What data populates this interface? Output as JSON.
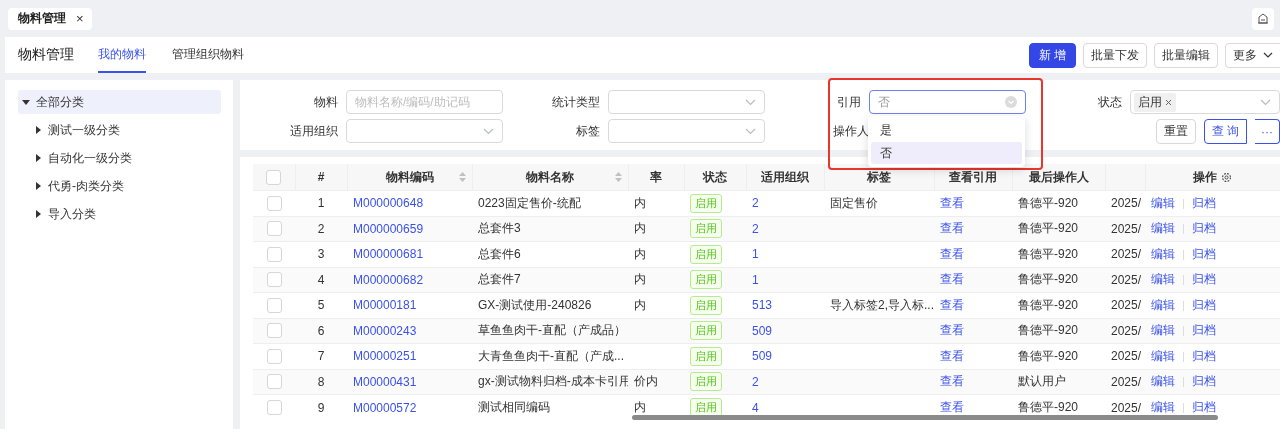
{
  "app_tabs": [
    {
      "label": "物料管理",
      "selected": true,
      "close": "×"
    }
  ],
  "header": {
    "title": "物料管理",
    "tabs": [
      {
        "label": "我的物料",
        "selected": true
      },
      {
        "label": "管理组织物料",
        "selected": false
      }
    ],
    "buttons": [
      {
        "label": "新 增",
        "kind": "primary"
      },
      {
        "label": "批量下发",
        "kind": "default"
      },
      {
        "label": "批量编辑",
        "kind": "default"
      },
      {
        "label": "更多",
        "kind": "dropdown"
      }
    ]
  },
  "tree": [
    {
      "label": "全部分类",
      "expanded": true,
      "selected": true,
      "children": [
        {
          "label": "测试一级分类",
          "expanded": false,
          "selected": false
        },
        {
          "label": "自动化一级分类",
          "expanded": false,
          "selected": false
        },
        {
          "label": "代勇-肉类分类",
          "expanded": false,
          "selected": false
        },
        {
          "label": "导入分类",
          "expanded": false,
          "selected": false
        }
      ]
    }
  ],
  "filters": [
    {
      "label": "物料",
      "kind": "text",
      "placeholder": "物料名称/编码/助记码"
    },
    {
      "label": "统计类型",
      "kind": "select"
    },
    {
      "label": "引用",
      "kind": "select",
      "value": "否",
      "focused": true
    },
    {
      "label": "状态",
      "kind": "tags",
      "tags": [
        "启用"
      ]
    },
    {
      "label": "适用组织",
      "kind": "select"
    },
    {
      "label": "标签",
      "kind": "select"
    },
    {
      "label": "操作人",
      "kind": "covered"
    }
  ],
  "filter_buttons": [
    {
      "label": "重置",
      "kind": "default"
    },
    {
      "label": "查 询",
      "kind": "outline"
    },
    {
      "label": "···",
      "kind": "more"
    }
  ],
  "dropdown": {
    "options": [
      {
        "label": "是",
        "selected": false
      },
      {
        "label": "否",
        "selected": true
      }
    ]
  },
  "table": {
    "all_checked": false,
    "columns": [
      {
        "label": "#",
        "kind": "index"
      },
      {
        "label": "物料编码",
        "kind": "link",
        "sortable": true
      },
      {
        "label": "物料名称",
        "kind": "text",
        "sortable": true
      },
      {
        "label": "率",
        "kind": "text"
      },
      {
        "label": "状态",
        "kind": "tag"
      },
      {
        "label": "适用组织",
        "kind": "link"
      },
      {
        "label": "标签",
        "kind": "text"
      },
      {
        "label": "查看引用",
        "kind": "link"
      },
      {
        "label": "最后操作人",
        "kind": "text"
      },
      {
        "kind": "text"
      },
      {
        "label": "操作",
        "kind": "actions"
      }
    ],
    "rows": [
      {
        "checked": false,
        "cells": [
          "1",
          "M000000648",
          "0223固定售价-统配",
          "内",
          "启用",
          "2",
          "固定售价",
          "查看",
          "鲁德平-920",
          "2025/",
          [
            "编辑",
            "归档"
          ]
        ]
      },
      {
        "checked": false,
        "cells": [
          "2",
          "M000000659",
          "总套件3",
          "内",
          "启用",
          "2",
          null,
          "查看",
          "鲁德平-920",
          "2025/",
          [
            "编辑",
            "归档"
          ]
        ]
      },
      {
        "checked": false,
        "cells": [
          "3",
          "M000000681",
          "总套件6",
          "内",
          "启用",
          "1",
          null,
          "查看",
          "鲁德平-920",
          "2025/",
          [
            "编辑",
            "归档"
          ]
        ]
      },
      {
        "checked": false,
        "cells": [
          "4",
          "M000000682",
          "总套件7",
          "内",
          "启用",
          "1",
          null,
          "查看",
          "鲁德平-920",
          "2025/",
          [
            "编辑",
            "归档"
          ]
        ]
      },
      {
        "checked": false,
        "cells": [
          "5",
          "M00000181",
          "GX-测试使用-240826",
          "内",
          "启用",
          "513",
          "导入标签2,导入标...",
          "查看",
          "鲁德平-920",
          "2025/",
          [
            "编辑",
            "归档"
          ]
        ]
      },
      {
        "checked": false,
        "cells": [
          "6",
          "M00000243",
          "草鱼鱼肉干-直配（产成品）",
          null,
          "启用",
          "509",
          null,
          "查看",
          "鲁德平-920",
          "2025/",
          [
            "编辑",
            "归档"
          ]
        ]
      },
      {
        "checked": false,
        "cells": [
          "7",
          "M00000251",
          "大青鱼鱼肉干-直配（产成...",
          null,
          "启用",
          "509",
          null,
          "查看",
          "鲁德平-920",
          "2025/",
          [
            "编辑",
            "归档"
          ]
        ]
      },
      {
        "checked": false,
        "cells": [
          "8",
          "M00000431",
          "gx-测试物料归档-成本卡引用",
          "价内",
          "启用",
          "2",
          null,
          "查看",
          "默认用户",
          "2025/",
          [
            "编辑",
            "归档"
          ]
        ]
      },
      {
        "checked": false,
        "cells": [
          "9",
          "M00000572",
          "测试相同编码",
          "内",
          "启用",
          "4",
          null,
          "查看",
          "鲁德平-920",
          "2025/",
          [
            "编辑",
            "归档"
          ]
        ]
      }
    ]
  }
}
